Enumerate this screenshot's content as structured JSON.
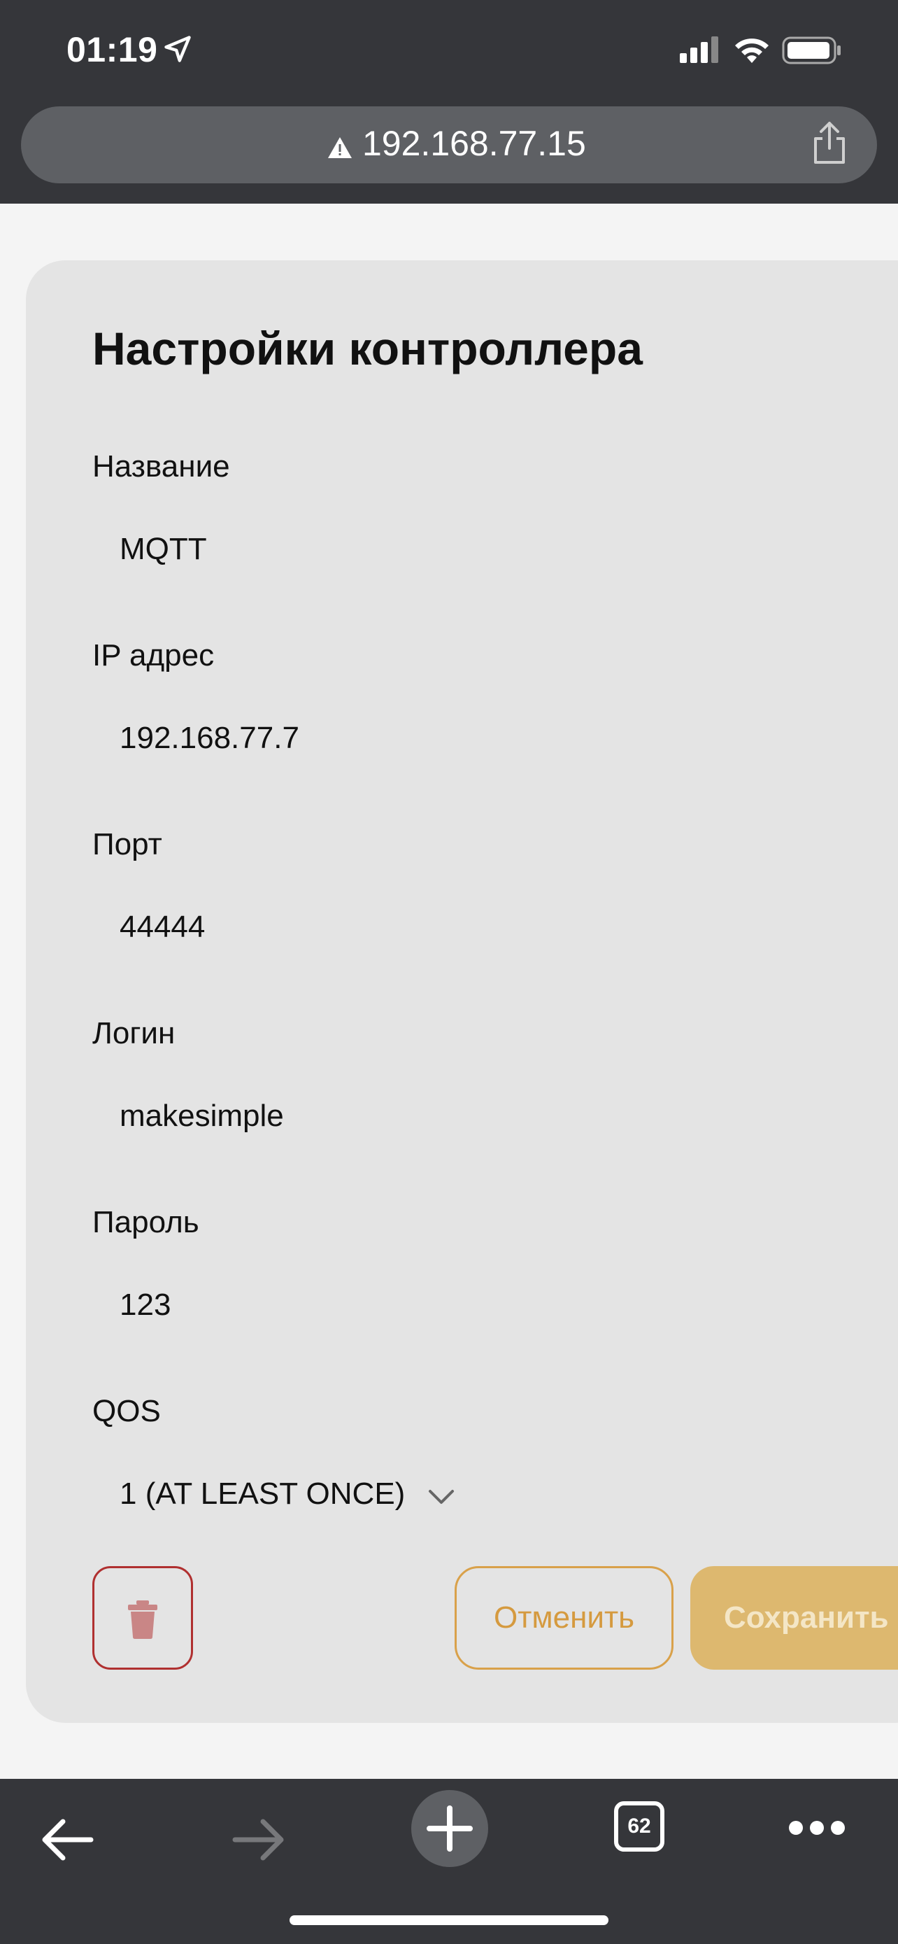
{
  "status_bar": {
    "time": "01:19"
  },
  "browser": {
    "url": "192.168.77.15",
    "tab_count": "62"
  },
  "form": {
    "title": "Настройки контроллера",
    "fields": [
      {
        "label": "Название",
        "value": "MQTT"
      },
      {
        "label": "IP адрес",
        "value": "192.168.77.7"
      },
      {
        "label": "Порт",
        "value": "44444"
      },
      {
        "label": "Логин",
        "value": "makesimple"
      },
      {
        "label": "Пароль",
        "value": "123"
      }
    ],
    "qos": {
      "label": "QOS",
      "selected": "1 (AT LEAST ONCE)"
    },
    "buttons": {
      "cancel": "Отменить",
      "save": "Сохранить"
    }
  },
  "colors": {
    "chrome_bg": "#35363a",
    "url_bar_bg": "#5e6064",
    "card_bg": "#e4e4e4",
    "accent": "#d9a14a",
    "save_bg": "#ddb86f",
    "delete_border": "#b03030"
  },
  "icons": {
    "status": [
      "location-arrow-icon",
      "cellular-signal-icon",
      "wifi-icon",
      "battery-icon"
    ],
    "url_bar": [
      "warning-icon",
      "share-icon"
    ],
    "toolbar": [
      "back-arrow-icon",
      "forward-arrow-icon",
      "plus-icon",
      "more-icon"
    ],
    "form": [
      "chevron-down-icon",
      "trash-icon"
    ]
  }
}
